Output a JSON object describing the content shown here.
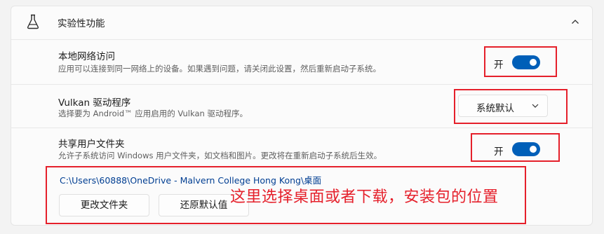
{
  "section": {
    "title": "实验性功能",
    "icon": "flask-icon",
    "expanded": true
  },
  "local_network": {
    "title": "本地网络访问",
    "description": "应用可以连接到同一网络上的设备。如果遇到问题，请关闭此设置，然后重新启动子系统。",
    "toggle_state": "开",
    "on": true
  },
  "vulkan": {
    "title": "Vulkan 驱动程序",
    "description": "选择要为 Android™ 应用启用的 Vulkan 驱动程序。",
    "selected": "系统默认"
  },
  "shared_folder": {
    "title": "共享用户文件夹",
    "description": "允许子系统访问 Windows 用户文件夹，如文档和图片。更改将在重新启动子系统后生效。",
    "toggle_state": "开",
    "on": true,
    "path": "C:\\Users\\60888\\OneDrive - Malvern College Hong Kong\\桌面",
    "change_button": "更改文件夹",
    "reset_button": "还原默认值"
  },
  "annotation": {
    "note": "这里选择桌面或者下载，安装包的位置",
    "color": "#e5202b"
  },
  "colors": {
    "accent": "#005fb8",
    "link": "#003e92"
  }
}
